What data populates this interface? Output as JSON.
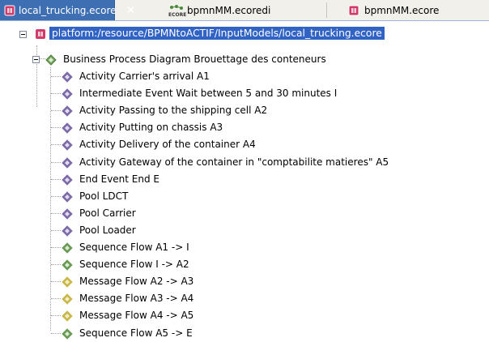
{
  "tabs": [
    {
      "label": "local_trucking.ecore",
      "active": true,
      "icon": "ecore-package-icon",
      "closable": true
    },
    {
      "label": "bpmnMM.ecoredi",
      "active": false,
      "icon": "ecore-diagram-icon"
    },
    {
      "label": "bpmnMM.ecore",
      "active": false,
      "icon": "ecore-package-icon"
    }
  ],
  "tabs_close": "✕",
  "tree": {
    "resource": {
      "label": "platform:/resource/BPMNtoACTIF/InputModels/local_trucking.ecore",
      "icon": "ecore-package-icon",
      "expanded": true
    },
    "diagram": {
      "label": "Business Process Diagram Brouettage des conteneurs",
      "icon": "diamond-icon",
      "expanded": true
    },
    "items": [
      {
        "label": "Activity Carrier's arrival A1",
        "icon": "diamond-purple-icon"
      },
      {
        "label": "Intermediate Event Wait between 5 and 30 minutes I",
        "icon": "diamond-purple-icon"
      },
      {
        "label": "Activity Passing to the shipping cell A2",
        "icon": "diamond-purple-icon"
      },
      {
        "label": "Activity Putting on chassis A3",
        "icon": "diamond-purple-icon"
      },
      {
        "label": "Activity Delivery of the container A4",
        "icon": "diamond-purple-icon"
      },
      {
        "label": "Activity Gateway of the container in  \"comptabilite matieres\" A5",
        "icon": "diamond-purple-icon"
      },
      {
        "label": "End Event End E",
        "icon": "diamond-purple-icon"
      },
      {
        "label": "Pool LDCT",
        "icon": "diamond-purple-icon"
      },
      {
        "label": "Pool Carrier",
        "icon": "diamond-purple-icon"
      },
      {
        "label": "Pool Loader",
        "icon": "diamond-purple-icon"
      },
      {
        "label": "Sequence Flow A1 -> I",
        "icon": "diamond-green-icon"
      },
      {
        "label": "Sequence Flow I -> A2",
        "icon": "diamond-green-icon"
      },
      {
        "label": "Message Flow A2 -> A3",
        "icon": "diamond-yellow-icon"
      },
      {
        "label": "Message Flow A3 -> A4",
        "icon": "diamond-yellow-icon"
      },
      {
        "label": "Message Flow A4 -> A5",
        "icon": "diamond-yellow-icon"
      },
      {
        "label": "Sequence Flow A5 -> E",
        "icon": "diamond-green-icon"
      }
    ]
  },
  "colors": {
    "selection": "#3163c5",
    "tab_active": "#3f6fb3",
    "purple_icon": "#7d6aa8",
    "green_icon": "#6a9a55",
    "yellow_icon": "#c8b84a"
  }
}
